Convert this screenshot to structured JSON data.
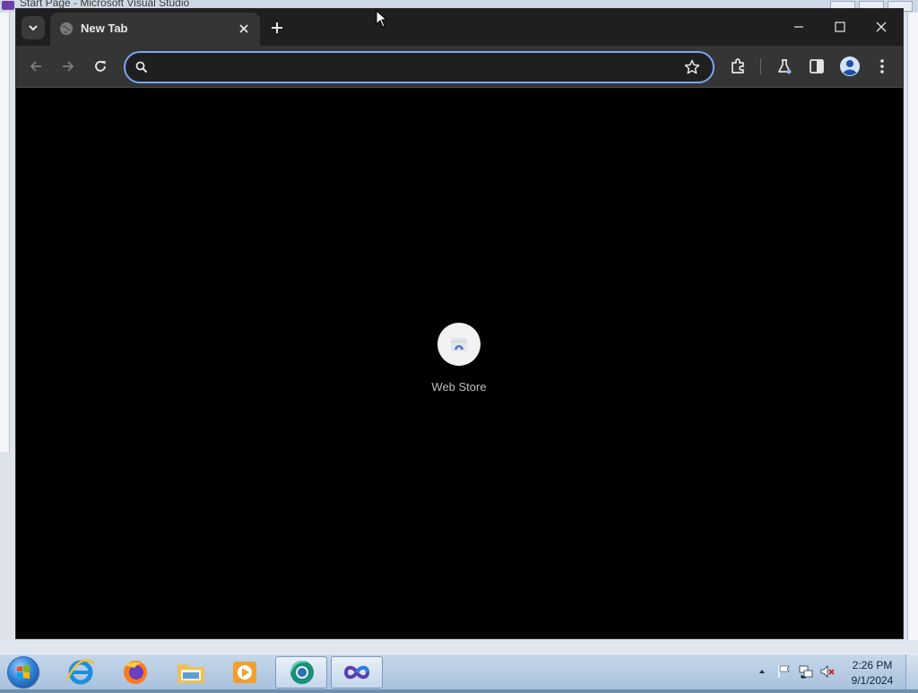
{
  "background_window": {
    "title": "Start Page - Microsoft Visual Studio"
  },
  "browser": {
    "tab": {
      "title": "New Tab",
      "favicon": "globe-icon"
    },
    "toolbar": {
      "back_icon": "back-arrow-icon",
      "forward_icon": "forward-arrow-icon",
      "reload_icon": "reload-icon",
      "omnibox": {
        "value": "",
        "search_icon": "search-icon",
        "bookmark_icon": "star-icon"
      },
      "extensions_icon": "puzzle-icon",
      "labs_icon": "flask-icon",
      "side_panel_icon": "side-panel-icon",
      "profile_icon": "profile-avatar-icon",
      "menu_icon": "three-dot-menu-icon"
    },
    "window_controls": [
      "minimize",
      "maximize",
      "close"
    ],
    "new_tab_page": {
      "shortcuts": [
        {
          "label": "Web Store",
          "icon": "web-store-icon"
        }
      ]
    },
    "colors": {
      "tab_strip": "#1f1f1f",
      "toolbar": "#353535",
      "omnibox_focus_ring": "#7aa6f5",
      "page_background": "#000000"
    }
  },
  "taskbar": {
    "pinned": [
      {
        "name": "internet-explorer",
        "active": false
      },
      {
        "name": "firefox",
        "active": false
      },
      {
        "name": "file-explorer",
        "active": false
      },
      {
        "name": "media-player",
        "active": false
      },
      {
        "name": "chrome-dev-browser",
        "active": true
      },
      {
        "name": "visual-studio",
        "active": true
      }
    ],
    "clock": {
      "time": "2:26 PM",
      "date": "9/1/2024"
    }
  }
}
